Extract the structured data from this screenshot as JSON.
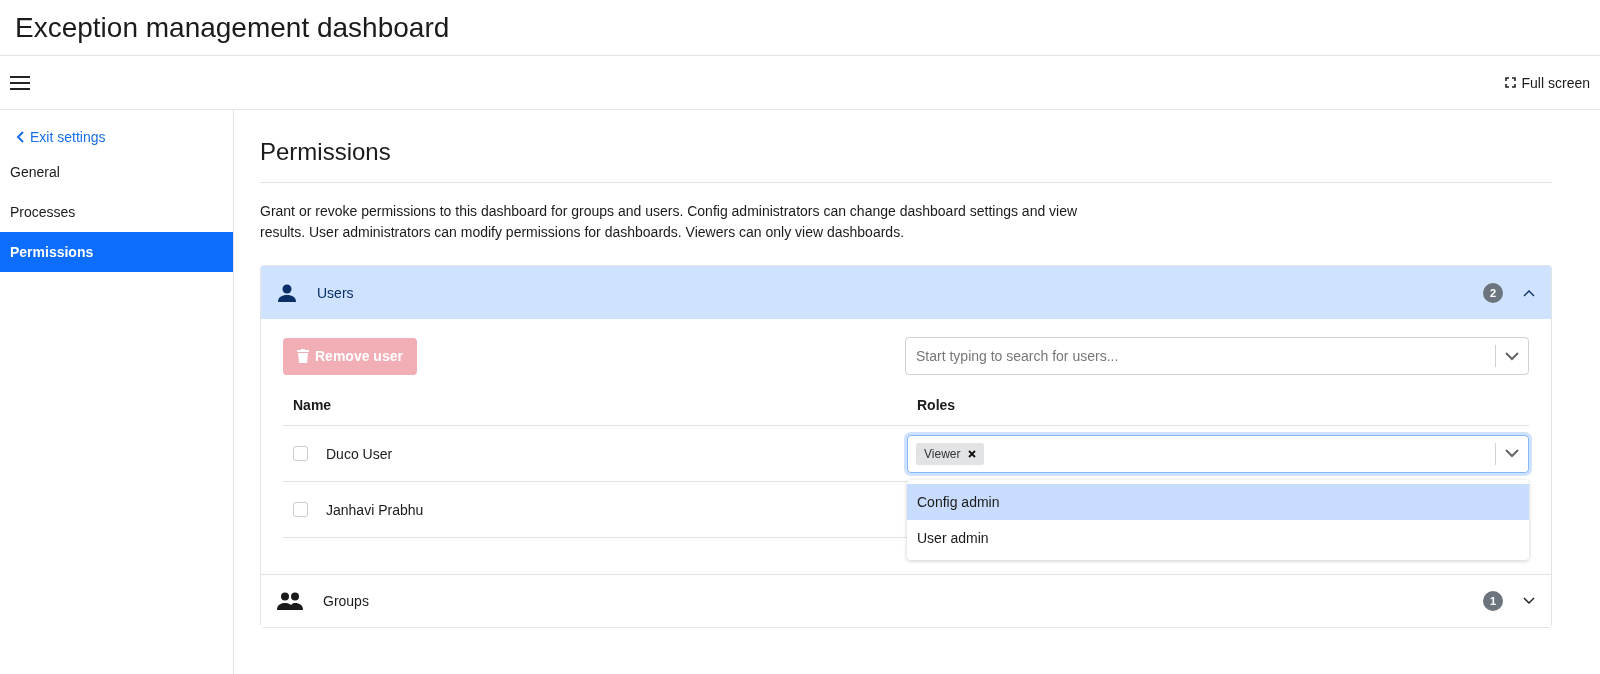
{
  "header": {
    "title": "Exception management dashboard"
  },
  "toolbar": {
    "full_screen": "Full screen"
  },
  "sidebar": {
    "back_link": "Exit settings",
    "items": [
      {
        "label": "General",
        "selected": false
      },
      {
        "label": "Processes",
        "selected": false
      },
      {
        "label": "Permissions",
        "selected": true
      }
    ]
  },
  "content": {
    "title": "Permissions",
    "description": "Grant or revoke permissions to this dashboard for groups and users. Config administrators can change dashboard settings and view results. User administrators can modify permissions for dashboards. Viewers can only view dashboards.",
    "sections": [
      {
        "kind": "users",
        "label": "Users",
        "count": "2",
        "expanded": true,
        "remove_button": {
          "label": "Remove user",
          "disabled": true
        },
        "search": {
          "placeholder": "Start typing to search for users..."
        },
        "columns": [
          "Name",
          "Roles"
        ],
        "rows": [
          {
            "name": "Duco User",
            "checked": false,
            "roles": [
              "Viewer"
            ],
            "open": true,
            "menu": [
              {
                "label": "Config admin",
                "selected": true
              },
              {
                "label": "User admin",
                "selected": false
              }
            ]
          },
          {
            "name": "Janhavi Prabhu",
            "checked": false,
            "roles": []
          }
        ]
      },
      {
        "kind": "groups",
        "label": "Groups",
        "count": "1",
        "expanded": false
      }
    ]
  }
}
